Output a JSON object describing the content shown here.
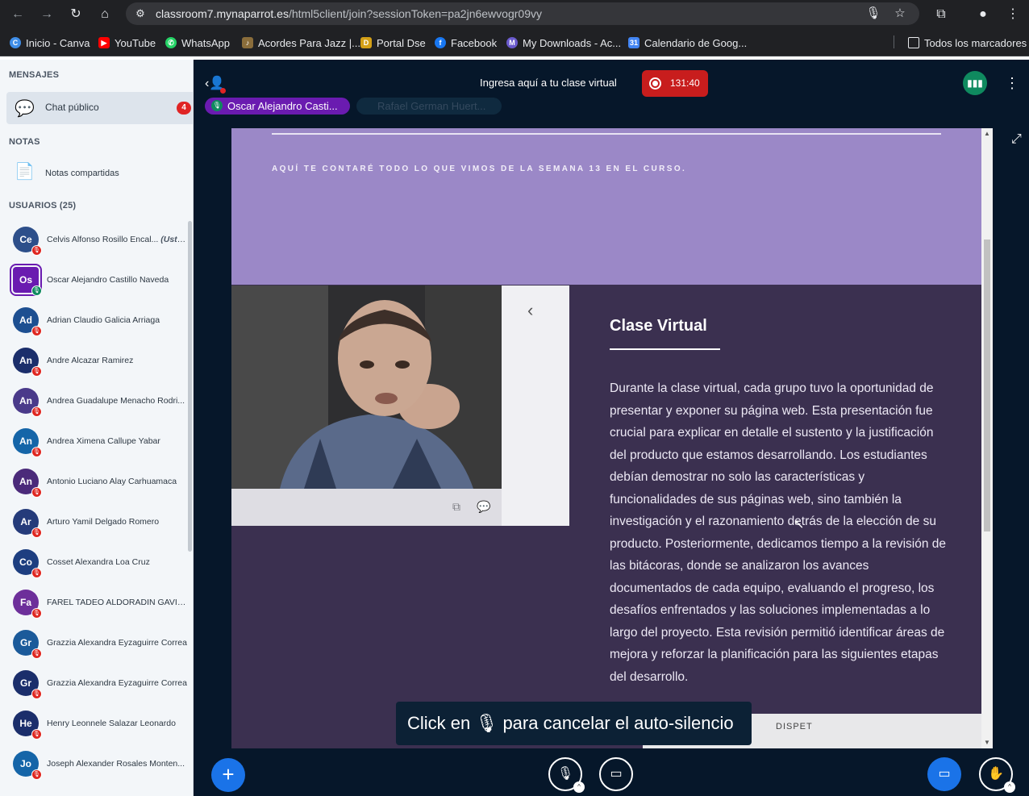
{
  "browser": {
    "url_host": "classroom7.mynaparrot.es",
    "url_path": "/html5client/join?sessionToken=pa2jn6ewvogr09vy",
    "bookmarks": [
      {
        "label": "Inicio - Canva",
        "color": "#3f8ee8"
      },
      {
        "label": "YouTube",
        "color": "#ff0000"
      },
      {
        "label": "WhatsApp",
        "color": "#25d366"
      },
      {
        "label": "Acordes Para Jazz |...",
        "color": "#8a6d3b"
      },
      {
        "label": "Portal Dse",
        "color": "#d4a017"
      },
      {
        "label": "Facebook",
        "color": "#1877f2"
      },
      {
        "label": "My Downloads - Ac...",
        "color": "#6a5acd"
      },
      {
        "label": "Calendario de Goog...",
        "color": "#4285f4"
      }
    ],
    "all_bookmarks": "Todos los marcadores"
  },
  "sidebar": {
    "messages_title": "MENSAJES",
    "public_chat": "Chat público",
    "unread": "4",
    "notes_title": "NOTAS",
    "shared_notes": "Notas compartidas",
    "users_title": "USUARIOS (25)",
    "you_suffix": "(Usted)",
    "users": [
      {
        "initials": "Ce",
        "name": "Celvis Alfonso Rosillo Encal...",
        "color": "#2d4f8a",
        "you": true
      },
      {
        "initials": "Os",
        "name": "Oscar Alejandro Castillo Naveda",
        "color": "#6a1bb0",
        "talking": true
      },
      {
        "initials": "Ad",
        "name": "Adrian Claudio Galicia Arriaga",
        "color": "#1d4f91"
      },
      {
        "initials": "An",
        "name": "Andre Alcazar Ramirez",
        "color": "#1b2e6b"
      },
      {
        "initials": "An",
        "name": "Andrea Guadalupe Menacho Rodri...",
        "color": "#4a3a8a"
      },
      {
        "initials": "An",
        "name": "Andrea Ximena Callupe Yabar",
        "color": "#1565a8"
      },
      {
        "initials": "An",
        "name": "Antonio Luciano Alay Carhuamaca",
        "color": "#4b2a7a"
      },
      {
        "initials": "Ar",
        "name": "Arturo Yamil Delgado Romero",
        "color": "#253b7a"
      },
      {
        "initials": "Co",
        "name": "Cosset Alexandra Loa Cruz",
        "color": "#1d3e80"
      },
      {
        "initials": "Fa",
        "name": "FAREL TADEO ALDORADIN GAVIRIA",
        "color": "#6d2f9a"
      },
      {
        "initials": "Gr",
        "name": "Grazzia Alexandra Eyzaguirre Correa",
        "color": "#1b5a9a"
      },
      {
        "initials": "Gr",
        "name": "Grazzia Alexandra Eyzaguirre Correa",
        "color": "#1b2e6b"
      },
      {
        "initials": "He",
        "name": "Henry Leonnele Salazar Leonardo",
        "color": "#1b2e6b"
      },
      {
        "initials": "Jo",
        "name": "Joseph Alexander Rosales Monten...",
        "color": "#1565a8"
      }
    ]
  },
  "meeting": {
    "title": "Ingresa aquí a tu clase virtual",
    "recording_time": "131:40",
    "talkers": [
      "Oscar Alejandro Casti...",
      "Rafael German Huert..."
    ],
    "slide_tag": "AQUÍ TE CONTARÉ TODO LO QUE VIMOS DE LA SEMANA 13 EN EL CURSO.",
    "slide_heading": "Clase Virtual",
    "slide_body": "Durante la clase virtual, cada grupo tuvo la oportunidad de presentar y exponer su página web. Esta presentación fue crucial para explicar en detalle el sustento y la justificación del producto que estamos desarrollando. Los estudiantes debían demostrar no solo las características y funcionalidades de sus páginas web, sino también la investigación y el razonamiento detrás de la elección de su producto. Posteriormente, dedicamos tiempo a la revisión de las bitácoras, donde se analizaron los avances documentados de cada equipo, evaluando el progreso, los desafíos enfrentados y las soluciones implementadas a lo largo del proyecto. Esta revisión permitió identificar áreas de mejora y reforzar la planificación para las siguientes etapas del desarrollo.",
    "strip_label": "DISPET",
    "toast_before": "Click en",
    "toast_after": "para cancelar el auto-silencio"
  }
}
